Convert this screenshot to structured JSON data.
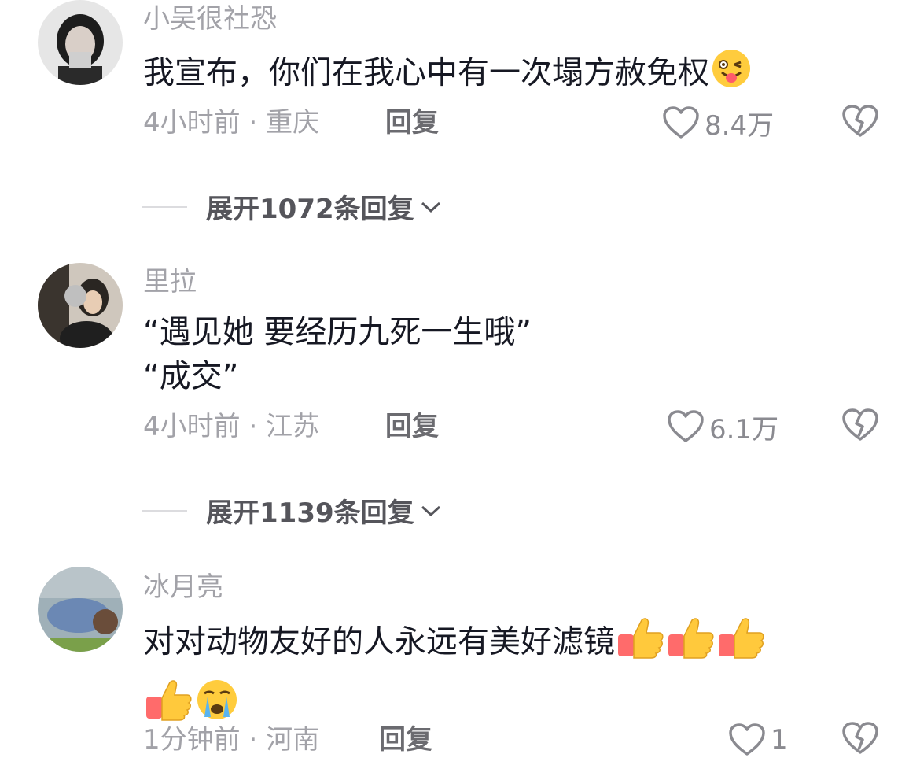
{
  "comments": [
    {
      "author": "小吴很社恐",
      "text_lines": [
        "我宣布，你们在我心中有一次塌方赦免权"
      ],
      "time": "4小时前",
      "location": "重庆",
      "reply_label": "回复",
      "likes": "8.4万",
      "expand_label": "展开1072条回复",
      "emoji_trailing": "winking-tongue-emoji"
    },
    {
      "author": "里拉",
      "text_lines": [
        "“遇见她 要经历九死一生哦”",
        "“成交”"
      ],
      "time": "4小时前",
      "location": "江苏",
      "reply_label": "回复",
      "likes": "6.1万",
      "expand_label": "展开1139条回复"
    },
    {
      "author": "冰月亮",
      "text_lines": [
        "对对动物友好的人永远有美好滤镜"
      ],
      "time": "1分钟前",
      "location": "河南",
      "reply_label": "回复",
      "likes": "1",
      "emoji_trailing": [
        "thumbs-up-emoji",
        "thumbs-up-emoji",
        "thumbs-up-emoji",
        "thumbs-up-emoji",
        "crying-face-emoji"
      ]
    }
  ],
  "separator": "·",
  "colors": {
    "text_primary": "#161823",
    "text_secondary": "#a2a2a8",
    "divider": "#dcdcdf"
  }
}
